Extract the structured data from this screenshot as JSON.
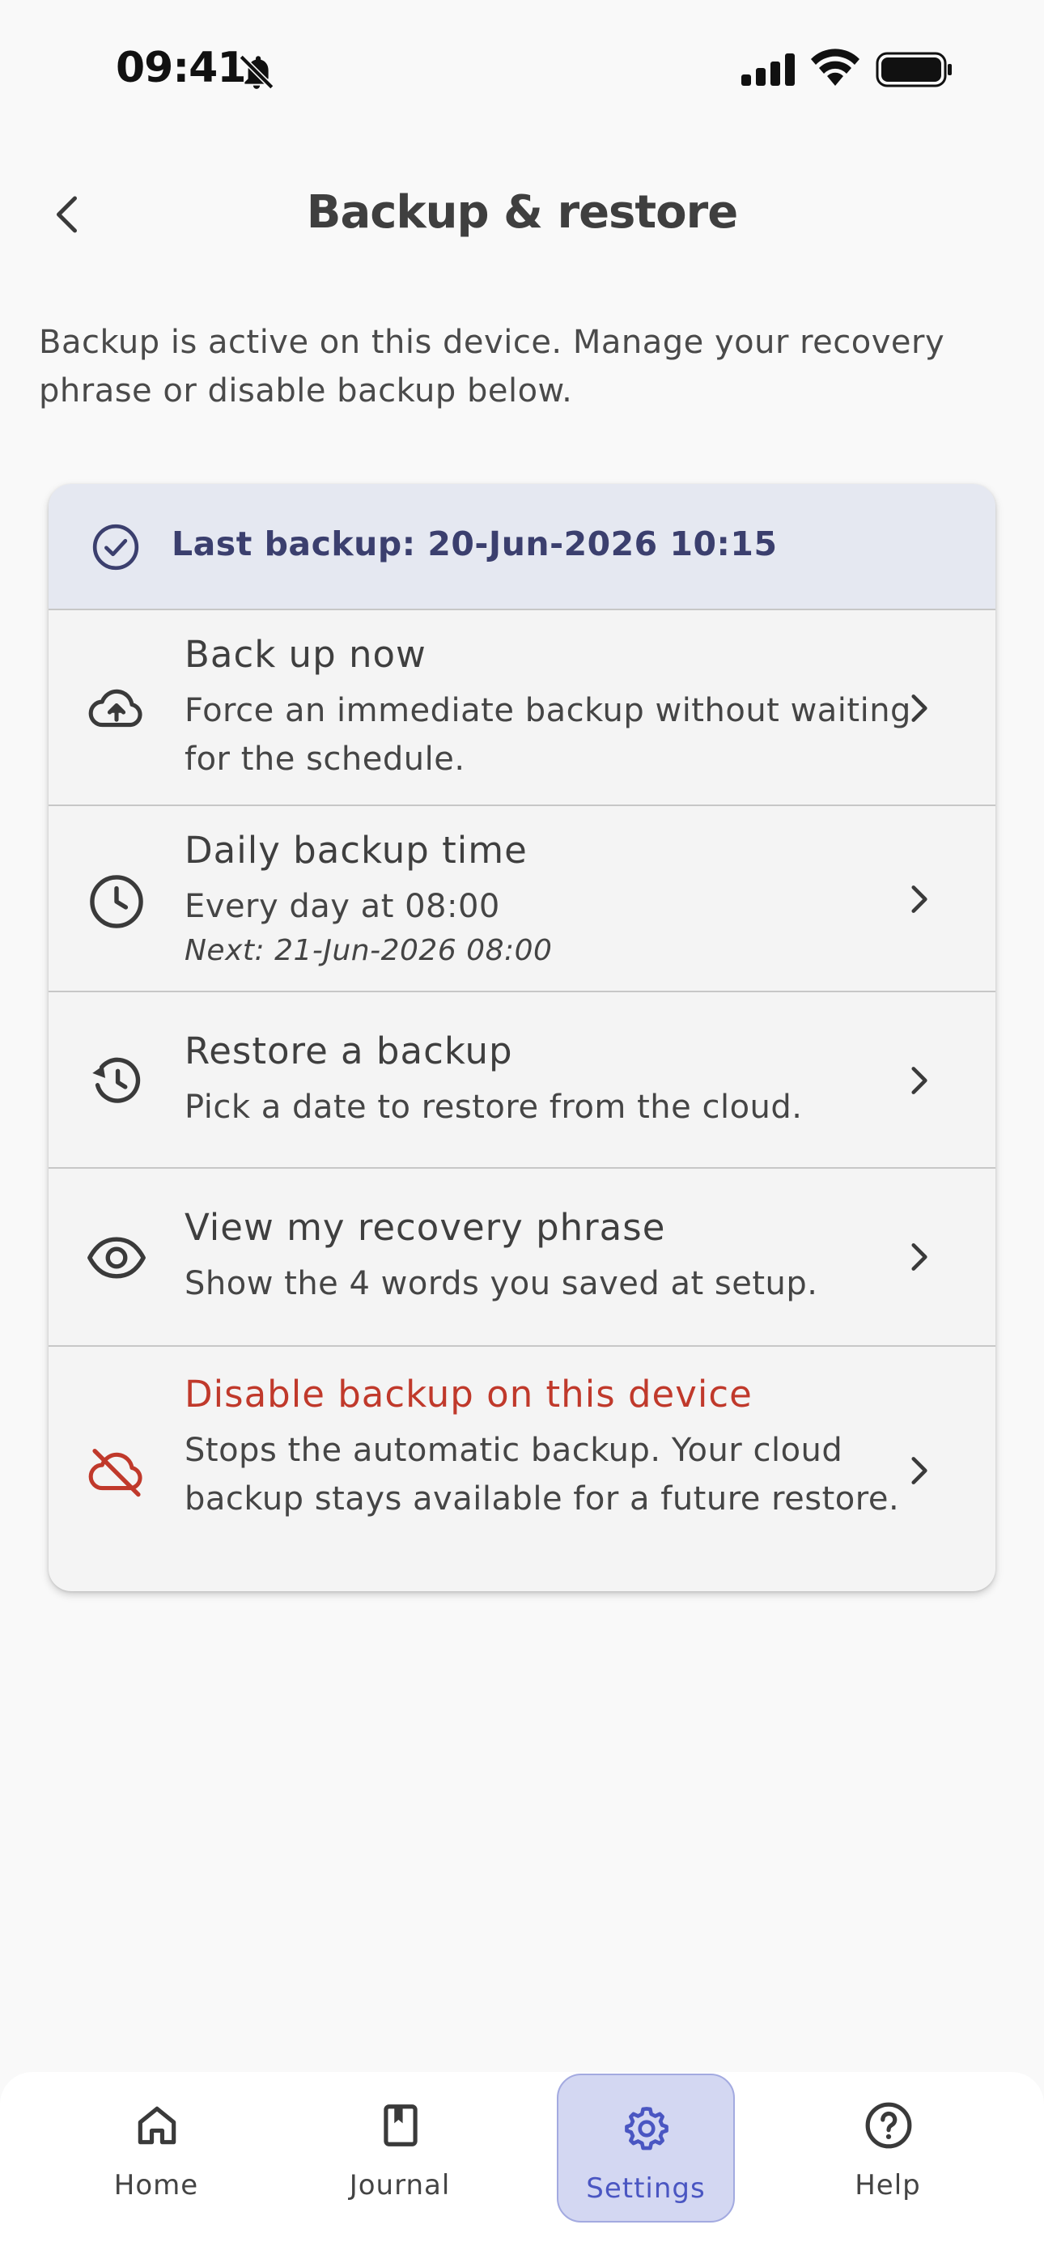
{
  "status_bar": {
    "time": "09:41"
  },
  "header": {
    "title": "Backup & restore"
  },
  "intro_text": "Backup is active on this device. Manage your recovery phrase or disable backup below.",
  "last_backup": {
    "label": "Last backup: 20-Jun-2026 10:15"
  },
  "rows": [
    {
      "title": "Back up now",
      "subtitle": "Force an immediate backup without waiting for the schedule.",
      "icon": "cloud-upload-icon"
    },
    {
      "title": "Daily backup time",
      "subtitle": "Every day at 08:00",
      "meta": "Next: 21-Jun-2026 08:00",
      "icon": "clock-icon"
    },
    {
      "title": "Restore a backup",
      "subtitle": "Pick a date to restore from the cloud.",
      "icon": "history-icon"
    },
    {
      "title": "View my recovery phrase",
      "subtitle": "Show the 4 words you saved at setup.",
      "icon": "eye-icon"
    },
    {
      "title": "Disable backup on this device",
      "subtitle": "Stops the automatic backup. Your cloud backup stays available for a future restore.",
      "icon": "cloud-off-icon",
      "danger": true
    }
  ],
  "nav": [
    {
      "label": "Home",
      "icon": "home-icon"
    },
    {
      "label": "Journal",
      "icon": "bookmark-icon"
    },
    {
      "label": "Settings",
      "icon": "gear-icon",
      "active": true
    },
    {
      "label": "Help",
      "icon": "help-icon"
    }
  ],
  "colors": {
    "accent": "#4a56c2",
    "banner_bg": "#e5e8f1",
    "banner_text": "#3b3f6e",
    "danger": "#c0392b",
    "active_tab_bg": "#d3d7f2"
  }
}
